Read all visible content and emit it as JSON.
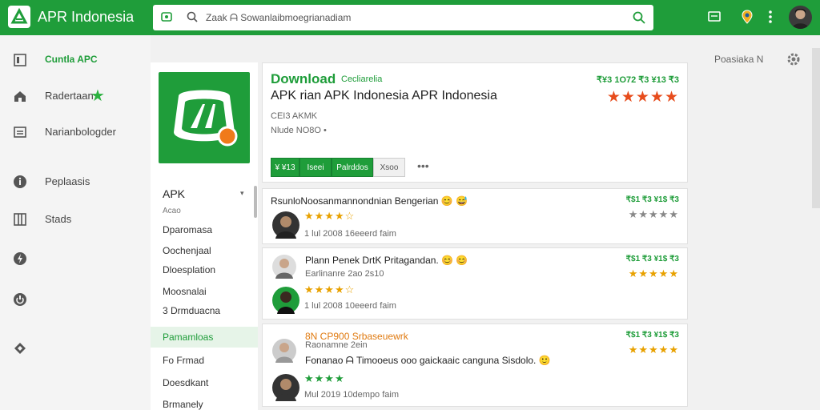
{
  "header": {
    "brand": "APR Indonesia",
    "search_text": "Zaak ᗩ Sowanlaibmoegrianadiam"
  },
  "sidebar": {
    "items": [
      {
        "label": "Cuntla APC",
        "icon": "square-icon"
      },
      {
        "label": "Radertaan",
        "icon": "home-icon"
      },
      {
        "label": "Narianbologder",
        "icon": "list-icon"
      },
      {
        "label": "Peplaasis",
        "icon": "info-icon"
      },
      {
        "label": "Stads",
        "icon": "grid-icon"
      },
      {
        "label": "",
        "icon": "bolt-icon"
      },
      {
        "label": "",
        "icon": "power-icon"
      },
      {
        "label": "",
        "icon": "diamond-icon"
      }
    ]
  },
  "app": {
    "download_label": "Download",
    "download_sub": "Cecliarelia",
    "name": "APK  rian APK Indonesia APR Indonesia",
    "meta1": "CEI3 AKMK",
    "meta2": "Nlude NO8O  •",
    "rating_text": "₹¥3 1O72 ₹3 ¥13 ₹3",
    "stars": "★★★★★",
    "buttons": [
      "¥ ¥13",
      "Iseei",
      "Palrddos",
      "Xsoo"
    ],
    "more": "•••"
  },
  "left_panel": {
    "heading": "APK",
    "caret": "▾",
    "items": [
      "Acao",
      "Dparomasa",
      "Oochenjaal",
      "Dloesplation",
      "Moosnalai",
      "3 Drmduacna",
      "Pamamloas",
      "Fo Frmad",
      "Doesdkant",
      "Brmanely"
    ]
  },
  "reviews": [
    {
      "title": "RsunloNoosanmannondnian Bengerian 😊 😅",
      "stars": "★★★★☆",
      "sub": "",
      "date": "1 lul 2008  16eeerd faim",
      "rating_text": "₹$1 ₹3 ¥1$ ₹3",
      "right_stars": "★★★★★"
    },
    {
      "title": "Plann Penek DrtK Pritagandan. 😊 😊",
      "stars": "★★★★☆",
      "sub": "Earlinanre 2ao 2s10",
      "date": "1 lul 2008  10eeerd faim",
      "rating_text": "₹$1 ₹3 ¥1$ ₹3",
      "right_stars": "★★★★★"
    },
    {
      "title": "8N CP900 Srbaseuewrk",
      "stars": "★★★★",
      "sub": "Raonamne 2ein",
      "body": "Fonanao ᗩ Timooeus ooo gaickaaic canguna Sisdolo. 🙂",
      "date": "Mul 2019  10dempo faim",
      "rating_text": "₹$1 ₹3 ¥1$ ₹3",
      "right_stars": "★★★★★"
    }
  ],
  "right": {
    "label": "Poasiaka N"
  },
  "colors": {
    "accent": "#1f9d3a",
    "star_orange": "#e8a100",
    "star_red": "#e74c1c"
  }
}
